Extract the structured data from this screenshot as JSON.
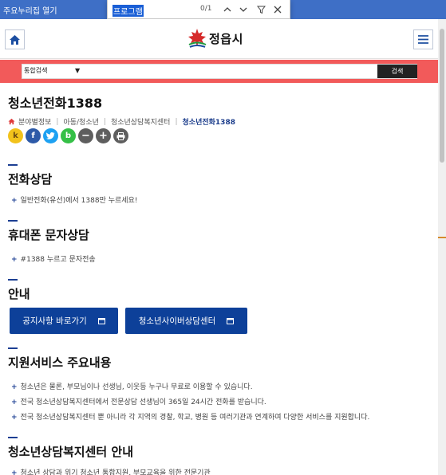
{
  "topbar": {
    "skip_link": "주요누리집 열기"
  },
  "find": {
    "query": "프로그램",
    "count": "0/1"
  },
  "header": {
    "logo_text": "정읍시"
  },
  "search": {
    "scope": "통합검색",
    "button": "검색"
  },
  "page": {
    "title": "청소년전화1388",
    "breadcrumb": [
      "분야별정보",
      "아동/청소년",
      "청소년상담복지센터",
      "청소년전화1388"
    ]
  },
  "share": {
    "kakaostory": "k",
    "facebook": "f",
    "twitter": "t",
    "band": "b",
    "zoom_out": "−",
    "zoom_in": "+",
    "print": "print"
  },
  "sections": {
    "phone": {
      "title": "전화상담",
      "items": [
        "일반전화(유선)에서 1388만 누르세요!"
      ]
    },
    "mobile": {
      "title": "휴대폰 문자상담",
      "items": [
        "#1388 누르고 문자전송"
      ]
    },
    "guide": {
      "title": "안내",
      "buttons": [
        "공지사항 바로가기",
        "청소년사이버상담센터"
      ]
    },
    "services": {
      "title": "지원서비스 주요내용",
      "items": [
        "청소년은 물론, 부모님이나 선생님, 이웃등 누구나 무료로 이용할 수 있습니다.",
        "전국 청소년상담복지센터에서 전문상담 선생님이 365일 24시간 전화를 받습니다.",
        "전국 청소년상담복지센터 뿐 아니라 각 지역의 경찰, 학교, 병원 등 여러기관과 연계하여 다양한 서비스를 지원합니다."
      ]
    },
    "center": {
      "title": "청소년상담복지센터 안내",
      "items": [
        "청소년 상담과 위기 청소년 통합지원, 부모교육을 위한 전문기관"
      ]
    }
  },
  "colors": {
    "topbar": "#3e6fc6",
    "search_strip": "#f25a5a",
    "accent": "#1c3f93",
    "button": "#0d4099"
  }
}
